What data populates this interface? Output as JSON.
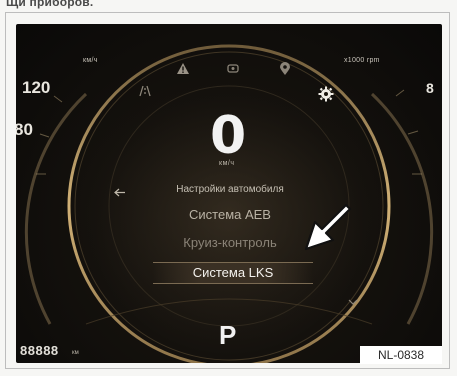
{
  "page": {
    "caption": "Щи приборов."
  },
  "cluster": {
    "left_gauge": {
      "unit": "км/ч",
      "tick_value_top": "120",
      "tick_value_side": "80"
    },
    "right_gauge": {
      "unit": "x1000 rpm",
      "tick_value": "8"
    },
    "speed": {
      "value": "0",
      "unit": "км/ч"
    },
    "menu": {
      "header": "Настройки автомобиля",
      "items": [
        {
          "label": "Система AEB"
        },
        {
          "label": "Круиз-контроль"
        }
      ],
      "selected_label": "Система LKS"
    },
    "gear": "P",
    "odometer": {
      "value": "88888",
      "unit": "км"
    },
    "icons": [
      "lane-warning-icon",
      "warning-triangle-icon",
      "engine-check-icon",
      "location-icon",
      "settings-gear-icon",
      "back-arrow-icon",
      "chevron-down-icon",
      "pointer-arrow-icon"
    ],
    "colors": {
      "gold_ring": "#b89a62",
      "background": "#14110d",
      "selected_row": "#3a3024"
    }
  },
  "figure_ref": "NL-0838"
}
